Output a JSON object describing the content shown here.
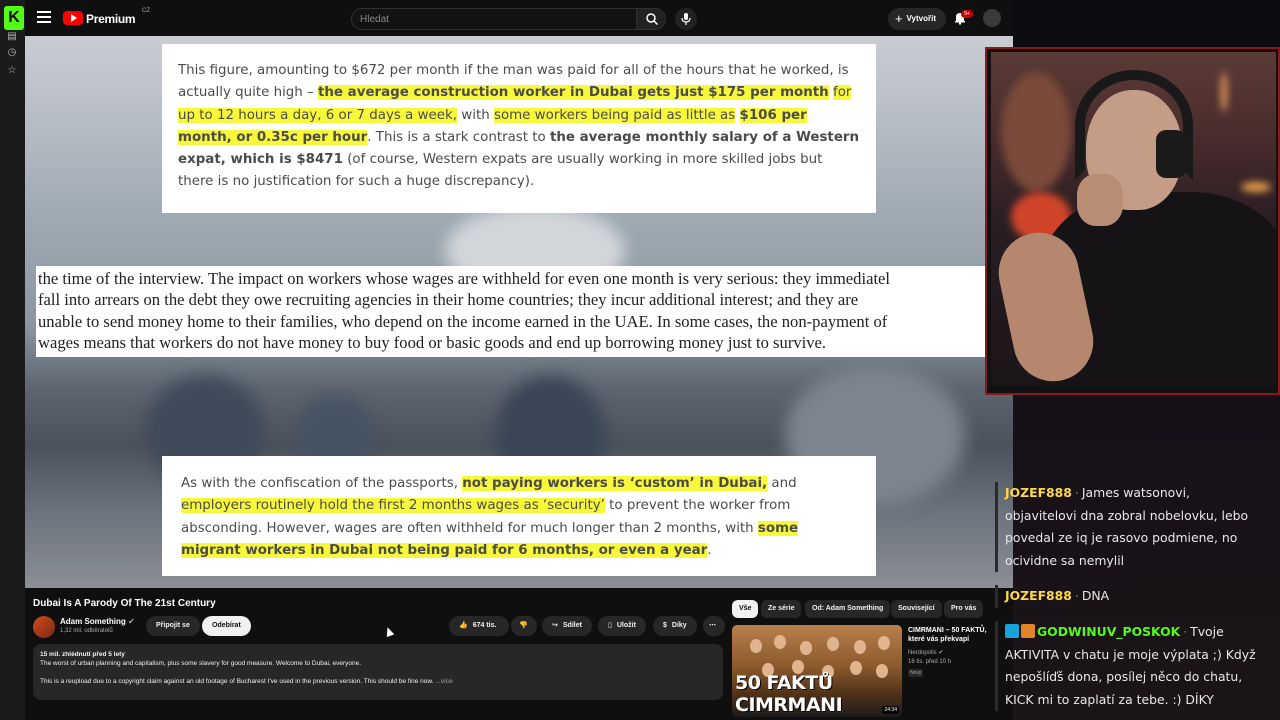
{
  "app": {
    "brand": "Premium",
    "region": "CZ"
  },
  "topbar": {
    "search_placeholder": "Hledat",
    "create_label": "Vytvořit",
    "notifications_badge": "9+"
  },
  "video_frame": {
    "card1_parts": [
      {
        "t": "This figure, amounting to $672 per month if the man was paid for all of the hours that he worked, is actually quite high – ",
        "s": ""
      },
      {
        "t": "the average construction worker in Dubai gets just $175 per month",
        "s": "hl b"
      },
      {
        "t": " ",
        "s": ""
      },
      {
        "t": "for up to 12 hours a day, 6 or 7 days a week,",
        "s": "hl"
      },
      {
        "t": " with ",
        "s": ""
      },
      {
        "t": "some workers being paid as little as",
        "s": "hl"
      },
      {
        "t": " ",
        "s": ""
      },
      {
        "t": "$106 per month, or 0.35c per hour",
        "s": "hl b"
      },
      {
        "t": ". This is a stark contrast to ",
        "s": ""
      },
      {
        "t": "the average monthly salary of a Western expat, which is $8471",
        "s": "b"
      },
      {
        "t": " (of course, Western expats are usually working in more skilled jobs but there is no justification for such a huge discrepancy).",
        "s": ""
      }
    ],
    "legal_lines": [
      "the time of the interview. The impact on workers whose wages are withheld for even one month is very serious: they immediatel",
      "fall into arrears on the debt they owe recruiting agencies in their home countries; they incur additional interest; and they are",
      "unable to send money home to their families, who depend on the income earned in the UAE. In some cases, the non-payment of",
      "wages means that workers do not have money to buy food or basic goods and end up borrowing money just to survive."
    ],
    "card2_parts": [
      {
        "t": "As with the confiscation of the passports, ",
        "s": ""
      },
      {
        "t": "not paying workers is ‘custom’ in Dubai,",
        "s": "hl b"
      },
      {
        "t": " and ",
        "s": ""
      },
      {
        "t": "employers routinely hold the first 2 months wages as ‘security’",
        "s": "hl"
      },
      {
        "t": " to prevent the worker from absconding. However, wages are often withheld for much longer than 2 months, with ",
        "s": ""
      },
      {
        "t": "some migrant workers in Dubai not being paid for 6 months, or even a year",
        "s": "hl b"
      },
      {
        "t": ".",
        "s": ""
      }
    ]
  },
  "video_info": {
    "title": "Dubai Is A Parody Of The 21st Century",
    "channel_name": "Adam Something",
    "subscribers": "1,32 mil. odběratelů",
    "join_label": "Připojit se",
    "subscribe_label": "Odebírat",
    "likes": "674 tis.",
    "share_label": "Sdílet",
    "save_label": "Uložit",
    "thanks_label": "Díky",
    "description": {
      "stats": "15 mil. zhlédnutí  před 5 lety",
      "line1": "The worst of urban planning and capitalism, plus some slavery for good measure. Welcome to Dubai, everyone.",
      "line2": "This is a reupload due to a copyright claim against an old footage of Bucharest I've used in the previous version. This should be fine now.",
      "more": "...více"
    }
  },
  "related": {
    "chips": [
      "Vše",
      "Ze série",
      "Od: Adam Something",
      "Související",
      "Pro vás"
    ],
    "video": {
      "title": "CIMRMANI – 50 FAKTŮ, které vás překvapí",
      "channel": "Nerdopolis",
      "meta": "16 tis.   před 10 h",
      "badge": "Nový",
      "thumb_text": "50 FAKTŮ CIMRMANI",
      "duration": "24:34"
    }
  },
  "chat": [
    {
      "user": "JOZEF888",
      "text": "James watsonovi, objavitelovi dna zobral nobelovku, lebo povedal ze iq je rasovo podmiene, no ocividne sa nemylil"
    },
    {
      "user": "JOZEF888",
      "text": "DNA"
    },
    {
      "user": "GODWINUV_POSKOK",
      "text": "Tvoje AKTIVITA v chatu je moje výplata ;) Když nepošlíďš dona, posílej něco do chatu, KICK mi to zaplatí za tebe. :) DÍKY"
    }
  ],
  "colors": {
    "highlight": "#f8f83a",
    "kick_green": "#53fc18",
    "youtube_red": "#ff0000",
    "chat_user": "#ffd84a",
    "webcam_border": "#8a1a1a"
  }
}
